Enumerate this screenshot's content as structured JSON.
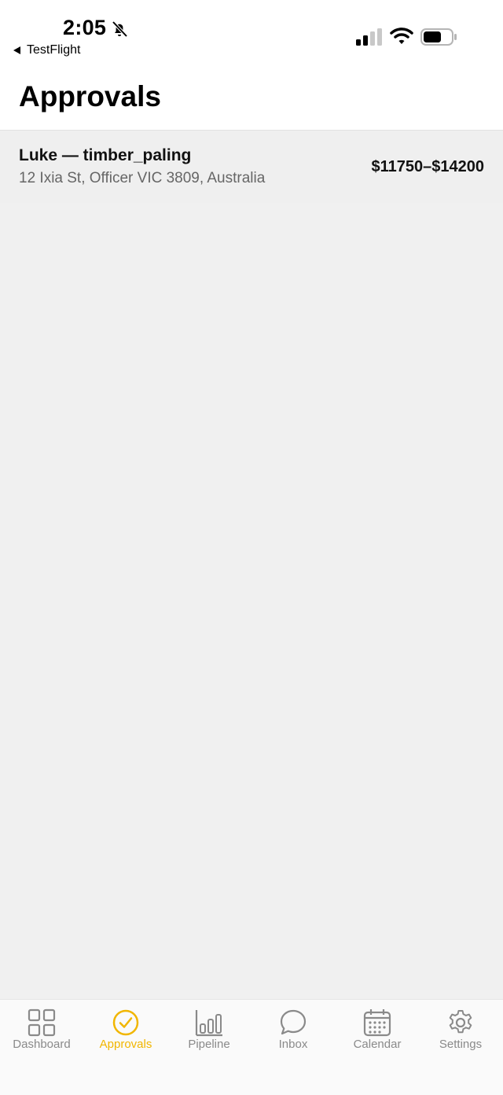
{
  "status_bar": {
    "time": "2:05",
    "back_app": "TestFlight",
    "icons": [
      "bell-slash-icon",
      "cellular-signal-icon",
      "wifi-icon",
      "battery-icon"
    ]
  },
  "header": {
    "title": "Approvals"
  },
  "approvals": [
    {
      "title": "Luke — timber_paling",
      "address": "12 Ixia St, Officer VIC 3809, Australia",
      "price": "$11750–$14200"
    }
  ],
  "tabs": [
    {
      "label": "Dashboard",
      "icon": "grid-icon",
      "active": false
    },
    {
      "label": "Approvals",
      "icon": "check-circle-icon",
      "active": true
    },
    {
      "label": "Pipeline",
      "icon": "bar-chart-icon",
      "active": false
    },
    {
      "label": "Inbox",
      "icon": "chat-bubble-icon",
      "active": false
    },
    {
      "label": "Calendar",
      "icon": "calendar-icon",
      "active": false
    },
    {
      "label": "Settings",
      "icon": "gear-icon",
      "active": false
    }
  ],
  "colors": {
    "accent": "#f1b600",
    "inactive": "#8a8a8a",
    "background": "#f0f0f0"
  }
}
